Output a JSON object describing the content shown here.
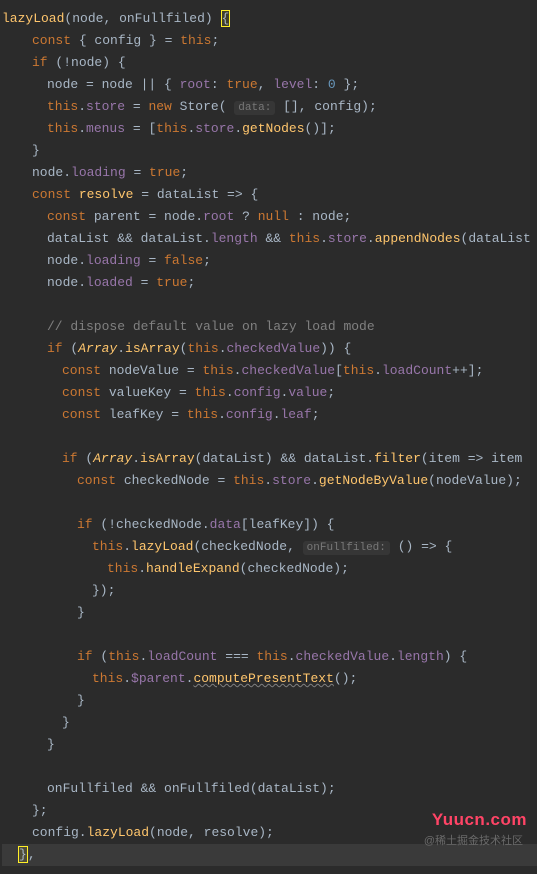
{
  "code": {
    "l1": {
      "fn": "lazyLoad",
      "p1": "node",
      "p2": "onFullfiled"
    },
    "l2": {
      "kw": "const",
      "destruct": "{ config } = ",
      "this": "this"
    },
    "l3": {
      "kw": "if",
      "cond": "!node"
    },
    "l4": {
      "assign": "node = node || { ",
      "k1": "root",
      "v1": "true",
      "k2": "level",
      "v2": "0",
      "end": " };"
    },
    "l5": {
      "this": "this",
      "prop": "store",
      "eq": " = ",
      "new": "new",
      "cls": "Store",
      "hint": "data:",
      "arr": "[]",
      "var": "config"
    },
    "l6": {
      "this": "this",
      "prop": "menus",
      "eq": " = [",
      "this2": "this",
      "prop2": "store",
      "fn": "getNodes",
      "end": "()];"
    },
    "l7": {
      "brace": "}"
    },
    "l8": {
      "var": "node",
      "prop": "loading",
      "eq": " = ",
      "val": "true"
    },
    "l9": {
      "kw": "const",
      "name": "resolve",
      "arrow": " = dataList => {"
    },
    "l10": {
      "kw": "const",
      "name": "parent",
      "eq": " = node.",
      "prop": "root",
      "q": " ? ",
      "null": "null",
      "colon": " : node;"
    },
    "l11": {
      "v1": "dataList && dataList.",
      "prop": "length",
      "and": " && ",
      "this": "this",
      "prop2": "store",
      "fn": "appendNodes",
      "arg": "(dataList"
    },
    "l12": {
      "var": "node",
      "prop": "loading",
      "eq": " = ",
      "val": "false"
    },
    "l13": {
      "var": "node",
      "prop": "loaded",
      "eq": " = ",
      "val": "true"
    },
    "l14": "",
    "l15": {
      "comment": "// dispose default value on lazy load mode"
    },
    "l16": {
      "kw": "if",
      "open": " (",
      "cls": "Array",
      "fn": "isArray",
      "this": "this",
      "prop": "checkedValue",
      "close": ")) {"
    },
    "l17": {
      "kw": "const",
      "name": "nodeValue",
      "eq": " = ",
      "this": "this",
      "prop": "checkedValue",
      "br": "[",
      "this2": "this",
      "prop2": "loadCount",
      "inc": "++];"
    },
    "l18": {
      "kw": "const",
      "name": "valueKey",
      "eq": " = ",
      "this": "this",
      "prop": "config",
      "prop2": "value"
    },
    "l19": {
      "kw": "const",
      "name": "leafKey",
      "eq": " = ",
      "this": "this",
      "prop": "config",
      "prop2": "leaf"
    },
    "l20": "",
    "l21": {
      "kw": "if",
      "open": " (",
      "cls": "Array",
      "fn": "isArray",
      "arg": "(dataList) && dataList.",
      "fn2": "filter",
      "arrow": "(item => item"
    },
    "l22": {
      "kw": "const",
      "name": "checkedNode",
      "eq": " = ",
      "this": "this",
      "prop": "store",
      "fn": "getNodeByValue",
      "arg": "(nodeValue);"
    },
    "l23": "",
    "l24": {
      "kw": "if",
      "cond": " (!checkedNode.",
      "prop": "data",
      "br": "[leafKey]) {"
    },
    "l25": {
      "this": "this",
      "fn": "lazyLoad",
      "arg": "(checkedNode, ",
      "hint": "onFullfiled:",
      "arrow": " () => {"
    },
    "l26": {
      "this": "this",
      "fn": "handleExpand",
      "arg": "(checkedNode);"
    },
    "l27": {
      "close": "});"
    },
    "l28": {
      "brace": "}"
    },
    "l29": "",
    "l30": {
      "kw": "if",
      "open": " (",
      "this": "this",
      "prop": "loadCount",
      "eq": " === ",
      "this2": "this",
      "prop2": "checkedValue",
      "prop3": "length",
      "close": ") {"
    },
    "l31": {
      "this": "this",
      "prop": "$parent",
      "fn": "computePresentText",
      "end": "();"
    },
    "l32": {
      "brace": "}"
    },
    "l33": {
      "brace": "}"
    },
    "l34": {
      "brace": "}"
    },
    "l35": "",
    "l36": {
      "call": "onFullfiled && onFullfiled(dataList);"
    },
    "l37": {
      "close": "};"
    },
    "l38": {
      "var": "config.",
      "fn": "lazyLoad",
      "args": "(node, resolve);"
    },
    "l39": {
      "close": "},"
    }
  },
  "brand": "Yuucn.com",
  "watermark": "@稀土掘金技术社区"
}
